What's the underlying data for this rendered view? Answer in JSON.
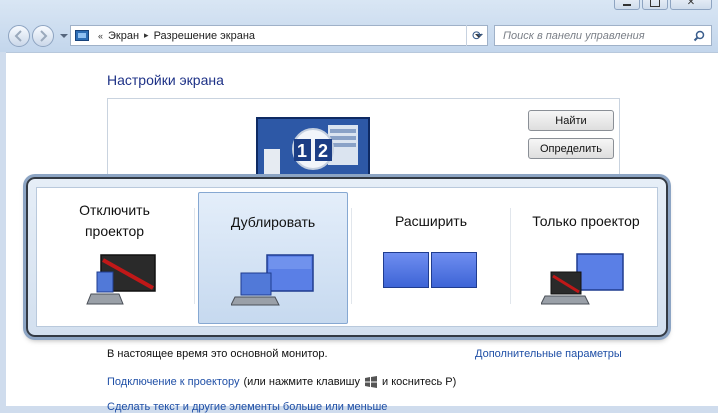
{
  "address_bar": {
    "crumbs": [
      "Экран",
      "Разрешение экрана"
    ]
  },
  "search": {
    "placeholder": "Поиск в панели управления"
  },
  "page": {
    "title": "Настройки экрана",
    "find_button": "Найти",
    "detect_button": "Определить",
    "monitor_numbers": [
      "1",
      "2"
    ]
  },
  "projector_options": [
    {
      "line1": "Отключить",
      "line2": "проектор"
    },
    {
      "line1": "Дублировать"
    },
    {
      "line1": "Расширить"
    },
    {
      "line1": "Только проектор"
    }
  ],
  "footer": {
    "primary_monitor_text": "В настоящее время это основной монитор.",
    "advanced_link": "Дополнительные параметры",
    "projector_link": "Подключение к проектору",
    "projector_hint": "(или нажмите клавишу",
    "projector_hint_end": "и коснитесь P)",
    "next_line_partial": "Сделать текст и другие элементы больше или меньше"
  }
}
